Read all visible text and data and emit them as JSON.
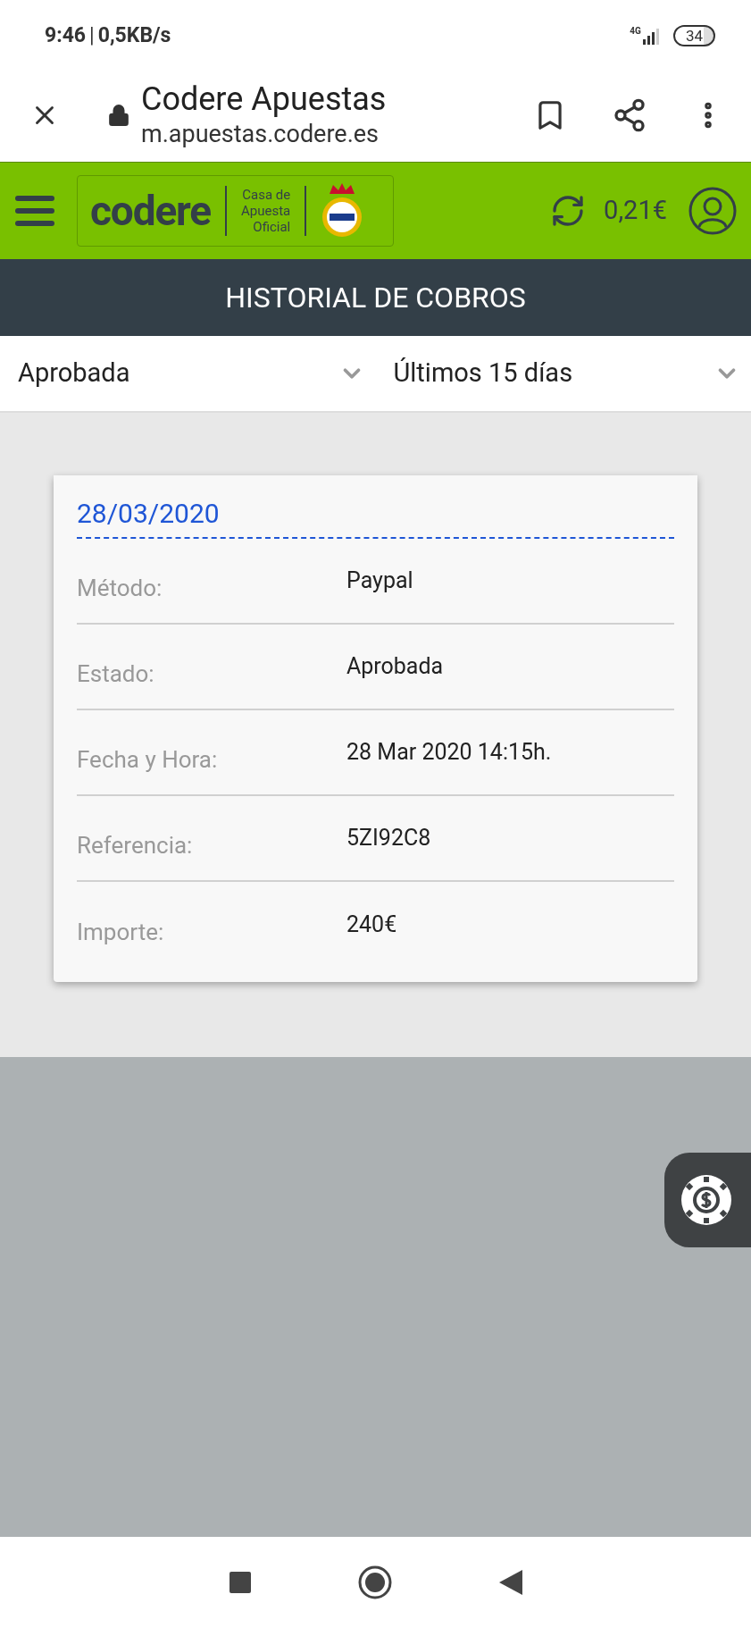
{
  "status_bar": {
    "time": "9:46",
    "separator": "|",
    "speed": "0,5KB/s",
    "network": "4G",
    "battery": "34"
  },
  "browser": {
    "title": "Codere Apuestas",
    "url": "m.apuestas.codere.es"
  },
  "header": {
    "logo": "codere",
    "logo_tagline": [
      "Casa de",
      "Apuesta",
      "Oficial"
    ],
    "balance": "0,21€"
  },
  "page_title": "HISTORIAL DE COBROS",
  "filters": [
    {
      "value": "Aprobada"
    },
    {
      "value": "Últimos 15 días"
    }
  ],
  "card": {
    "date": "28/03/2020",
    "rows": [
      {
        "label": "Método:",
        "value": "Paypal"
      },
      {
        "label": "Estado:",
        "value": "Aprobada"
      },
      {
        "label": "Fecha y Hora:",
        "value": "28 Mar 2020 14:15h."
      },
      {
        "label": "Referencia:",
        "value": "5ZI92C8"
      },
      {
        "label": "Importe:",
        "value": "240€"
      }
    ]
  }
}
